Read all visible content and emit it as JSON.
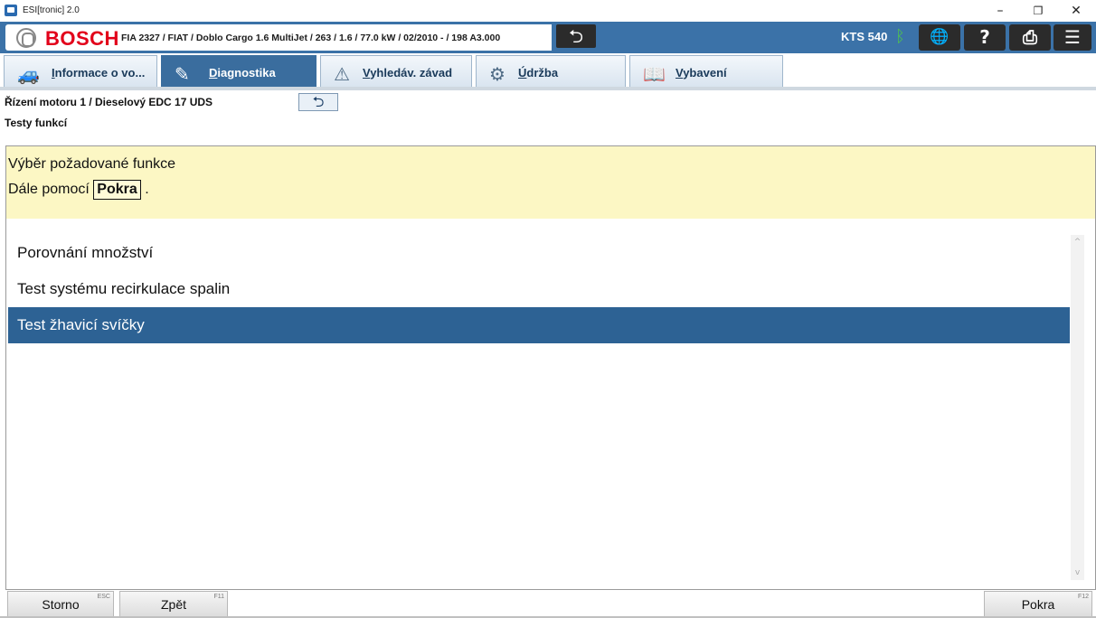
{
  "window": {
    "title": "ESI[tronic] 2.0",
    "minimize": "–",
    "restore": "❐",
    "close": "✕"
  },
  "header": {
    "brand": "BOSCH",
    "vehicle": "FIA 2327 / FIAT / Doblo Cargo 1.6 MultiJet / 263 / 1.6 / 77.0 kW / 02/2010 - / 198 A3.000",
    "device": "KTS 540",
    "icons": {
      "back": "back-arrow-icon",
      "bluetooth": "bluetooth-icon",
      "network": "network-error-icon",
      "help": "help-icon",
      "print": "print-icon",
      "menu": "menu-icon"
    }
  },
  "tabs": [
    {
      "label": "Informace o vo...",
      "icon": "car-info-icon",
      "active": false
    },
    {
      "label": "Diagnostika",
      "icon": "diagnostic-plug-icon",
      "active": true
    },
    {
      "label": "Vyhledáv. závad",
      "icon": "fault-search-icon",
      "active": false
    },
    {
      "label": "Údržba",
      "icon": "maintenance-icon",
      "active": false
    },
    {
      "label": "Vybavení",
      "icon": "book-icon",
      "active": false
    }
  ],
  "breadcrumb": {
    "path": "Řízení motoru 1 / Dieselový EDC 17 UDS",
    "subtitle": "Testy funkcí"
  },
  "info": {
    "line1": "Výběr požadované funkce",
    "line2_prefix": "Dále pomocí",
    "line2_key": "Pokra",
    "line2_suffix": "."
  },
  "list": {
    "items": [
      "Porovnání množství",
      "Test systému recirkulace spalin",
      "Test žhavicí svíčky"
    ],
    "selected_index": 2
  },
  "footer": {
    "cancel_label": "Storno",
    "cancel_key": "ESC",
    "back_label": "Zpět",
    "back_key": "F11",
    "next_label": "Pokra",
    "next_key": "F12"
  },
  "colors": {
    "header_blue": "#3b72a8",
    "selection_blue": "#2d6294",
    "info_yellow": "#fcf7c4",
    "bosch_red": "#e2001a"
  }
}
